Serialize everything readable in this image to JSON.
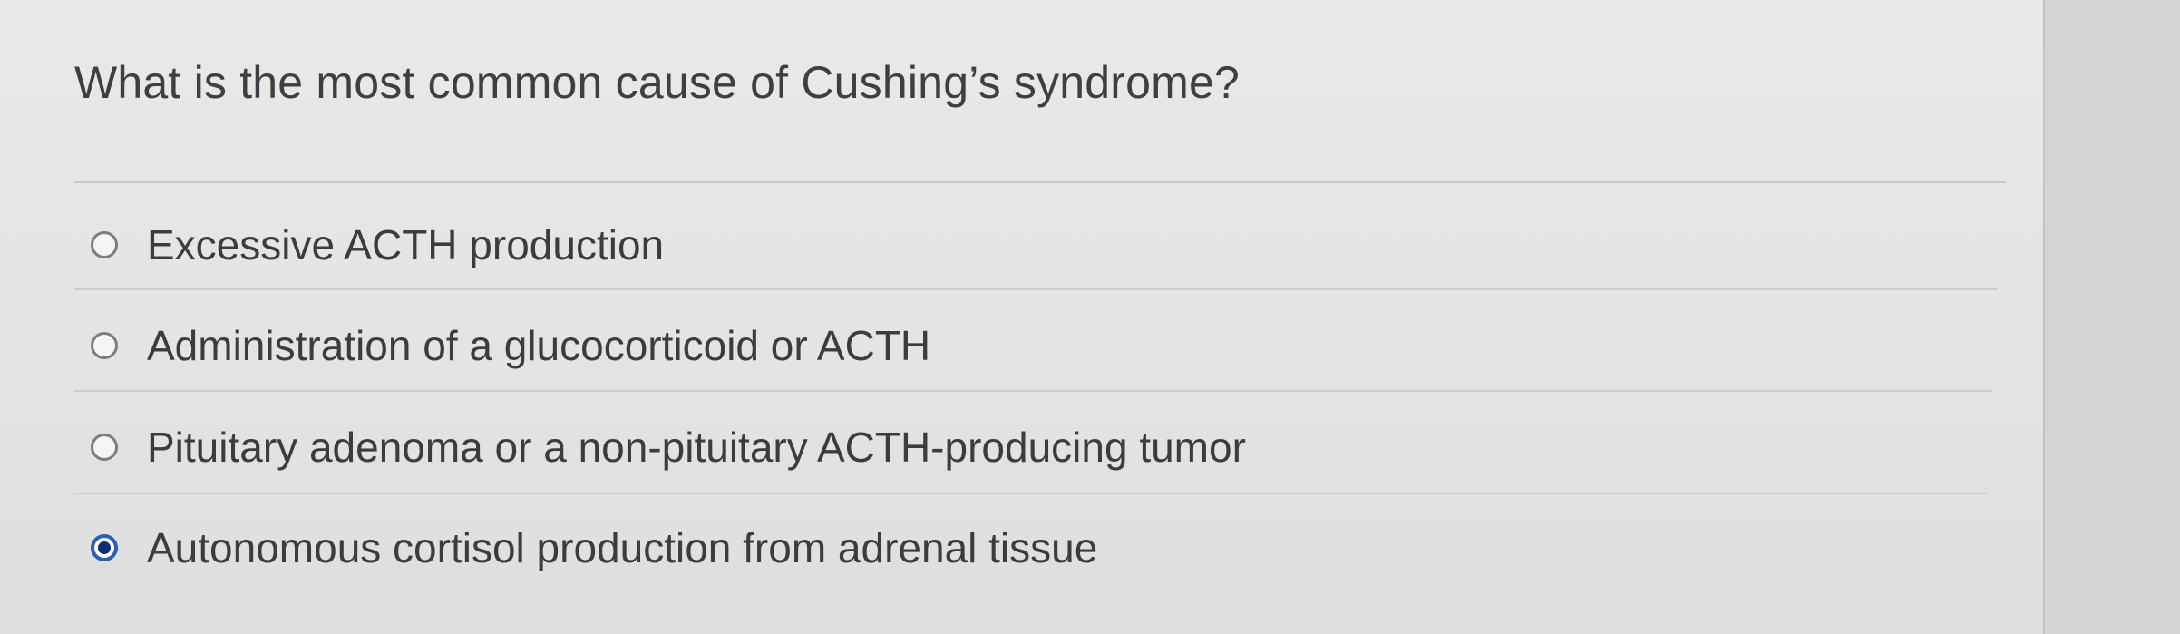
{
  "quiz": {
    "question": "What is the most common cause of Cushing’s syndrome?",
    "options": [
      {
        "label": "Excessive ACTH production",
        "selected": false
      },
      {
        "label": "Administration of a glucocorticoid or ACTH",
        "selected": false
      },
      {
        "label": "Pituitary adenoma or a non-pituitary ACTH-producing tumor",
        "selected": false
      },
      {
        "label": "Autonomous cortisol production from adrenal tissue",
        "selected": true
      }
    ],
    "colors": {
      "selected_radio": "#2a5fb8",
      "text": "#3a3c40",
      "background": "#e6e8e6"
    }
  }
}
